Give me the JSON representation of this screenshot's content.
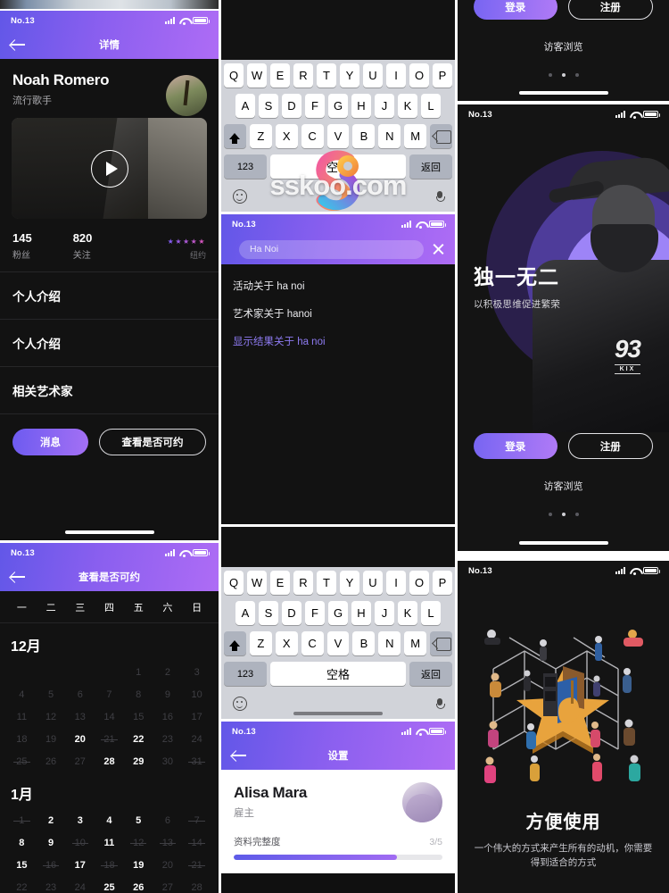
{
  "meta": {
    "watermark": "sskoo.com",
    "status_label": "No.13"
  },
  "artist_detail": {
    "title": "详情",
    "name": "Noah Romero",
    "role": "流行歌手",
    "stats": [
      {
        "value": "145",
        "label": "粉丝"
      },
      {
        "value": "820",
        "label": "关注"
      }
    ],
    "rating_stars": "★★★★★",
    "location": "纽约",
    "rows": [
      "个人介绍",
      "个人介绍",
      "相关艺术家"
    ],
    "primary_button": "消息",
    "secondary_button": "查看是否可约"
  },
  "calendar": {
    "title": "查看是否可约",
    "weekdays": [
      "一",
      "二",
      "三",
      "四",
      "五",
      "六",
      "日"
    ],
    "months": [
      {
        "name": "12月",
        "lead_blanks": 4,
        "days": [
          {
            "n": "1",
            "state": "off"
          },
          {
            "n": "2",
            "state": "off"
          },
          {
            "n": "3",
            "state": "off"
          },
          {
            "n": "4",
            "state": "off"
          },
          {
            "n": "5",
            "state": "off"
          },
          {
            "n": "6",
            "state": "off"
          },
          {
            "n": "7",
            "state": "off"
          },
          {
            "n": "8",
            "state": "off"
          },
          {
            "n": "9",
            "state": "off"
          },
          {
            "n": "10",
            "state": "off"
          },
          {
            "n": "11",
            "state": "off"
          },
          {
            "n": "12",
            "state": "off"
          },
          {
            "n": "13",
            "state": "off"
          },
          {
            "n": "14",
            "state": "off"
          },
          {
            "n": "15",
            "state": "off"
          },
          {
            "n": "16",
            "state": "off"
          },
          {
            "n": "17",
            "state": "off"
          },
          {
            "n": "18",
            "state": "off"
          },
          {
            "n": "19",
            "state": "off"
          },
          {
            "n": "20",
            "state": "sel"
          },
          {
            "n": "21",
            "state": "strike"
          },
          {
            "n": "22",
            "state": "on"
          },
          {
            "n": "23",
            "state": "off"
          },
          {
            "n": "24",
            "state": "off"
          },
          {
            "n": "25",
            "state": "strike"
          },
          {
            "n": "26",
            "state": "off"
          },
          {
            "n": "27",
            "state": "off"
          },
          {
            "n": "28",
            "state": "on"
          },
          {
            "n": "29",
            "state": "on"
          },
          {
            "n": "30",
            "state": "off"
          },
          {
            "n": "31",
            "state": "strike"
          }
        ]
      },
      {
        "name": "1月",
        "lead_blanks": 0,
        "days": [
          {
            "n": "1",
            "state": "strike"
          },
          {
            "n": "2",
            "state": "on"
          },
          {
            "n": "3",
            "state": "on"
          },
          {
            "n": "4",
            "state": "on"
          },
          {
            "n": "5",
            "state": "on"
          },
          {
            "n": "6",
            "state": "off"
          },
          {
            "n": "7",
            "state": "strike"
          },
          {
            "n": "8",
            "state": "on"
          },
          {
            "n": "9",
            "state": "on"
          },
          {
            "n": "10",
            "state": "strike"
          },
          {
            "n": "11",
            "state": "on"
          },
          {
            "n": "12",
            "state": "strike"
          },
          {
            "n": "13",
            "state": "strike"
          },
          {
            "n": "14",
            "state": "strike"
          },
          {
            "n": "15",
            "state": "on"
          },
          {
            "n": "16",
            "state": "strike"
          },
          {
            "n": "17",
            "state": "on"
          },
          {
            "n": "18",
            "state": "strike"
          },
          {
            "n": "19",
            "state": "on"
          },
          {
            "n": "20",
            "state": "off"
          },
          {
            "n": "21",
            "state": "strike"
          },
          {
            "n": "22",
            "state": "off"
          },
          {
            "n": "23",
            "state": "off"
          },
          {
            "n": "24",
            "state": "off"
          },
          {
            "n": "25",
            "state": "on"
          },
          {
            "n": "26",
            "state": "on"
          },
          {
            "n": "27",
            "state": "off"
          },
          {
            "n": "28",
            "state": "off"
          }
        ]
      }
    ]
  },
  "keyboard": {
    "row1": [
      "Q",
      "W",
      "E",
      "R",
      "T",
      "Y",
      "U",
      "I",
      "O",
      "P"
    ],
    "row2": [
      "A",
      "S",
      "D",
      "F",
      "G",
      "H",
      "J",
      "K",
      "L"
    ],
    "row3": [
      "Z",
      "X",
      "C",
      "V",
      "B",
      "N",
      "M"
    ],
    "num_key": "123",
    "space_key": "空格",
    "return_key": "返回"
  },
  "search": {
    "query": "Ha Noi",
    "results": [
      "活动关于 ha noi",
      "艺术家关于 hanoi"
    ],
    "show_all": "显示结果关于 ha noi"
  },
  "settings": {
    "title": "设置",
    "name": "Alisa Mara",
    "role": "雇主",
    "progress_label": "资料完整度",
    "progress_value": "3/5",
    "progress_percent": 78
  },
  "login": {
    "headline": "独一无二",
    "subhead": "以积极思维促进繁荣",
    "login_button": "登录",
    "register_button": "注册",
    "guest_link": "访客浏览"
  },
  "onboarding": {
    "headline": "方便使用",
    "body": "一个伟大的方式来产生所有的动机，你需要得到适合的方式"
  },
  "colors": {
    "accent": "#8463F0",
    "header_from": "#6257E8",
    "header_to": "#AE6CF5",
    "dark_bg": "#121212"
  }
}
